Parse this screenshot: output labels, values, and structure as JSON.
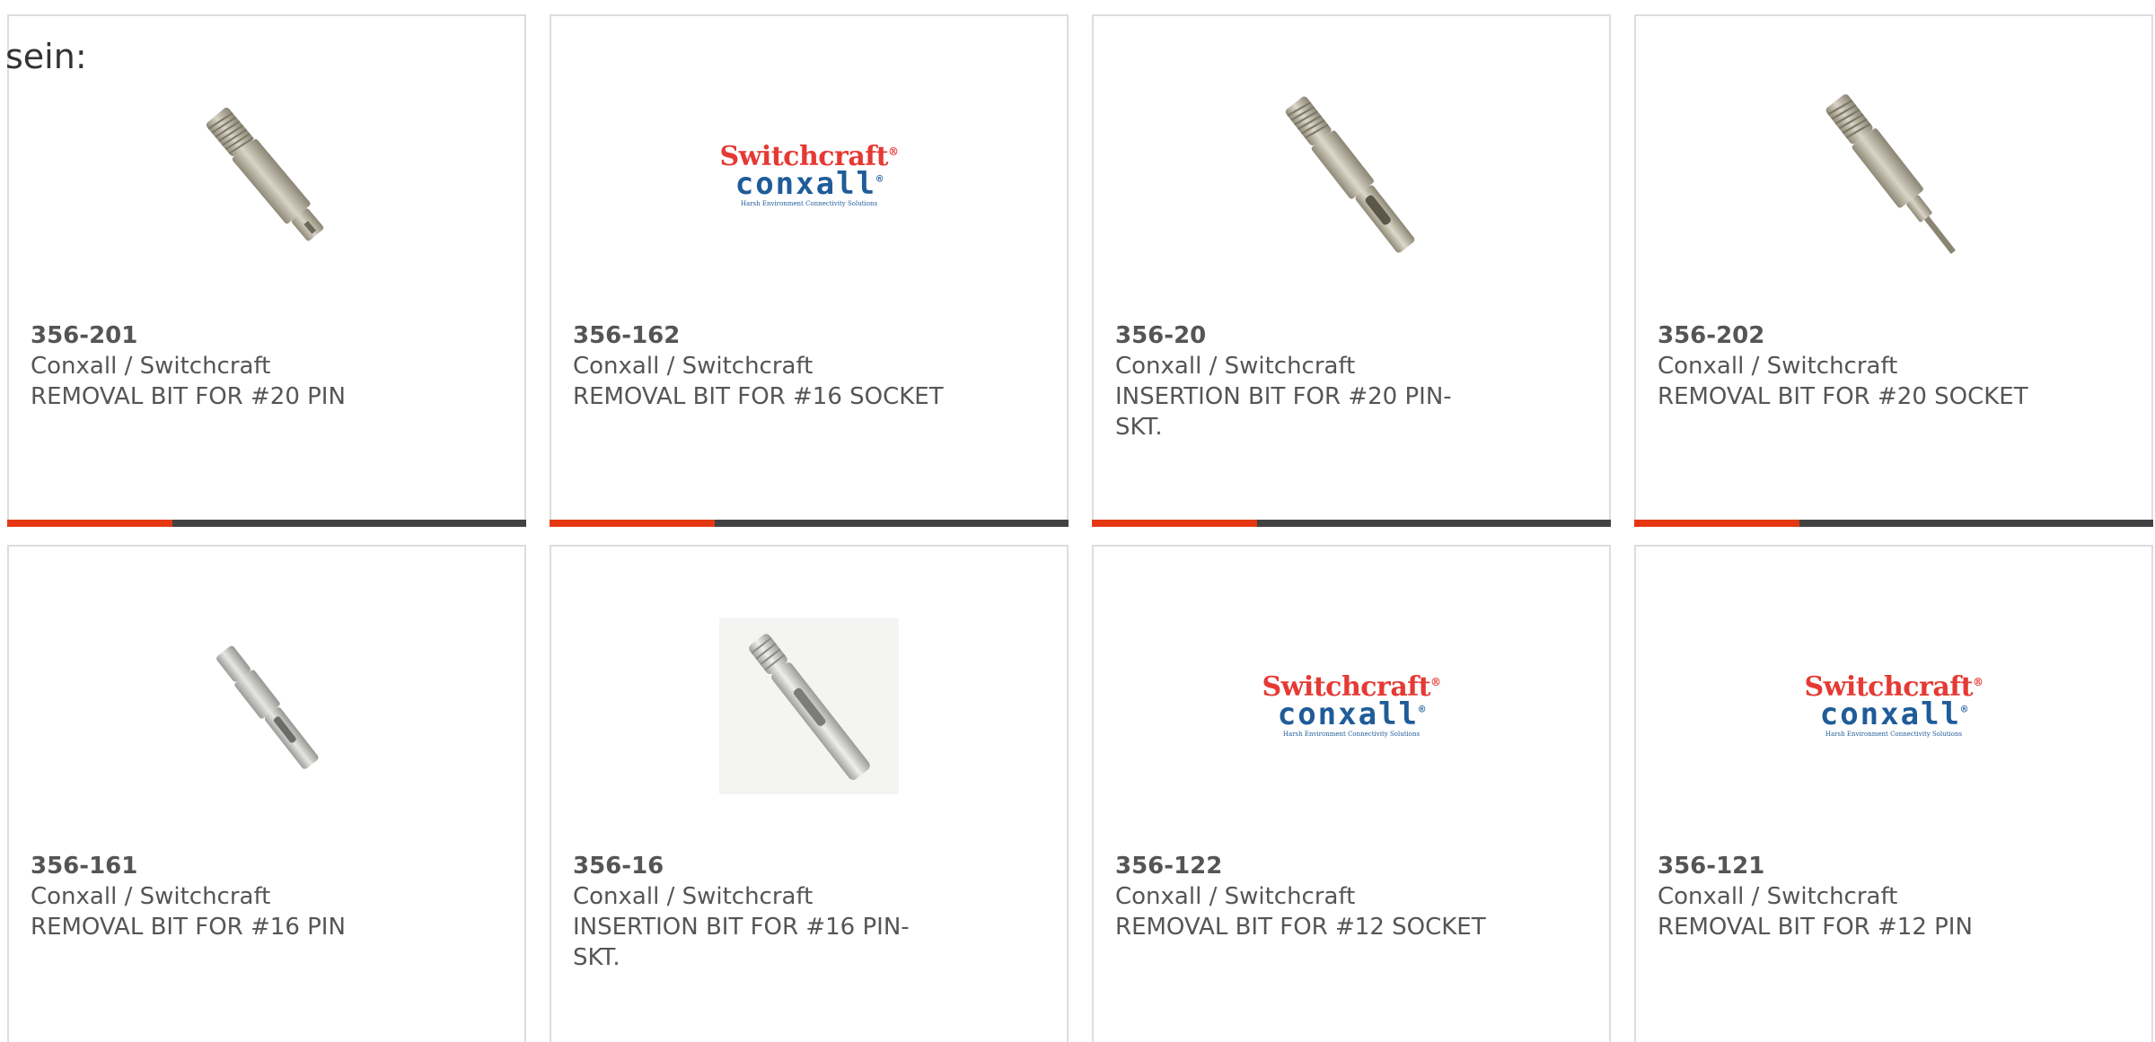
{
  "intro_text": "sein:",
  "colors": {
    "accent": "#e53812",
    "bar": "#424242",
    "border": "#dddddd",
    "text": "#555555"
  },
  "brand_logo": {
    "top": "Switchcraft",
    "mid": "conxall",
    "tagline": "Harsh Environment Connectivity Solutions"
  },
  "products": [
    {
      "pn": "356-201",
      "brand": "Conxall / Switchcraft",
      "desc": "REMOVAL BIT FOR #20 PIN",
      "image": "pin-tool-image"
    },
    {
      "pn": "356-162",
      "brand": "Conxall / Switchcraft",
      "desc": "REMOVAL BIT FOR #16 SOCKET",
      "image": "switchcraft-conxall-logo"
    },
    {
      "pn": "356-20",
      "brand": "Conxall / Switchcraft",
      "desc": "INSERTION BIT FOR #20 PIN-SKT.",
      "image": "insertion-bit-image"
    },
    {
      "pn": "356-202",
      "brand": "Conxall / Switchcraft",
      "desc": "REMOVAL BIT FOR #20 SOCKET",
      "image": "socket-tool-image"
    },
    {
      "pn": "356-161",
      "brand": "Conxall / Switchcraft",
      "desc": "REMOVAL BIT FOR #16 PIN",
      "image": "pin-tool-image"
    },
    {
      "pn": "356-16",
      "brand": "Conxall / Switchcraft",
      "desc": "INSERTION BIT FOR #16 PIN-SKT.",
      "image": "insertion-bit-image"
    },
    {
      "pn": "356-122",
      "brand": "Conxall / Switchcraft",
      "desc": "REMOVAL BIT FOR #12 SOCKET",
      "image": "switchcraft-conxall-logo"
    },
    {
      "pn": "356-121",
      "brand": "Conxall / Switchcraft",
      "desc": "REMOVAL BIT FOR #12 PIN",
      "image": "switchcraft-conxall-logo"
    }
  ]
}
